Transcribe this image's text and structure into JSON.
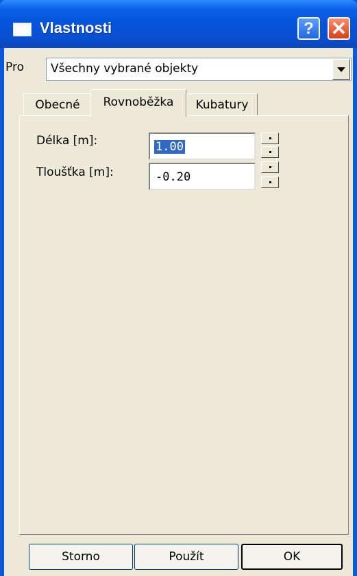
{
  "window": {
    "title": "Vlastnosti"
  },
  "titlebar": {
    "help": "?",
    "close": "✕"
  },
  "pro": {
    "label": "Pro",
    "value": "Všechny vybrané objekty"
  },
  "tabs": [
    {
      "label": "Obecné",
      "active": false
    },
    {
      "label": "Rovnoběžka",
      "active": true
    },
    {
      "label": "Kubatury",
      "active": false
    }
  ],
  "fields": {
    "delka": {
      "label": "Délka [m]:",
      "value": "1.00"
    },
    "tloustka": {
      "label": "Tloušťka [m]:",
      "value": "-0.20"
    }
  },
  "buttons": {
    "storno": "Storno",
    "pouzit": "Použít",
    "ok": "OK"
  }
}
